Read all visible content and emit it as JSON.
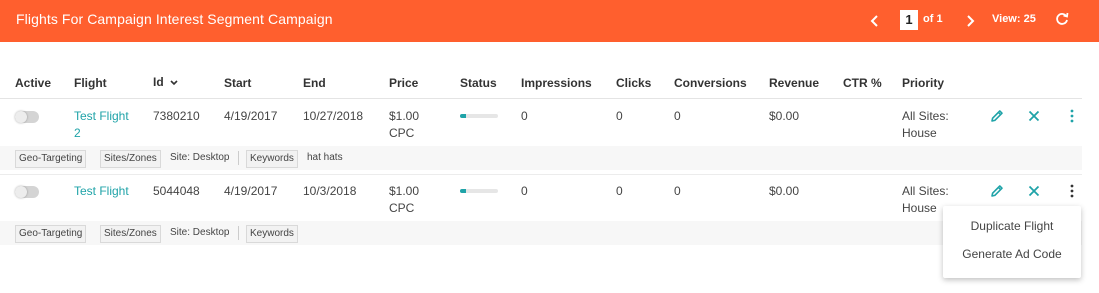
{
  "header": {
    "title": "Flights For Campaign Interest Segment Campaign",
    "page_current": "1",
    "page_of": "of 1",
    "view": "View: 25"
  },
  "columns": [
    "Active",
    "Flight",
    "Id",
    "Start",
    "End",
    "Price",
    "Status",
    "Impressions",
    "Clicks",
    "Conversions",
    "Revenue",
    "CTR %",
    "Priority"
  ],
  "sort_icon": "chevron-down-icon",
  "rows": [
    {
      "flight_line1": "Test Flight",
      "flight_line2": "2",
      "id": "7380210",
      "start": "4/19/2017",
      "end": "10/27/2018",
      "price_line1": "$1.00",
      "price_line2": "CPC",
      "status_progress": 0.15,
      "impressions": "0",
      "clicks": "0",
      "conversions": "0",
      "revenue": "$0.00",
      "ctr": "",
      "priority_line1": "All Sites:",
      "priority_line2": "House",
      "tags": {
        "geo": "Geo-Targeting",
        "sites": "Sites/Zones",
        "site_value": "Site: Desktop",
        "keywords": "Keywords",
        "keyword_value": "hat hats"
      }
    },
    {
      "flight_line1": "Test Flight",
      "flight_line2": "",
      "id": "5044048",
      "start": "4/19/2017",
      "end": "10/3/2018",
      "price_line1": "$1.00",
      "price_line2": "CPC",
      "status_progress": 0.15,
      "impressions": "0",
      "clicks": "0",
      "conversions": "0",
      "revenue": "$0.00",
      "ctr": "",
      "priority_line1": "All Sites:",
      "priority_line2": "House",
      "tags": {
        "geo": "Geo-Targeting",
        "sites": "Sites/Zones",
        "site_value": "Site: Desktop",
        "keywords": "Keywords",
        "keyword_value": ""
      }
    }
  ],
  "menu": {
    "duplicate": "Duplicate Flight",
    "generate": "Generate Ad Code"
  },
  "colors": {
    "brand": "#ff5f2e",
    "accent": "#1fa3a8"
  }
}
